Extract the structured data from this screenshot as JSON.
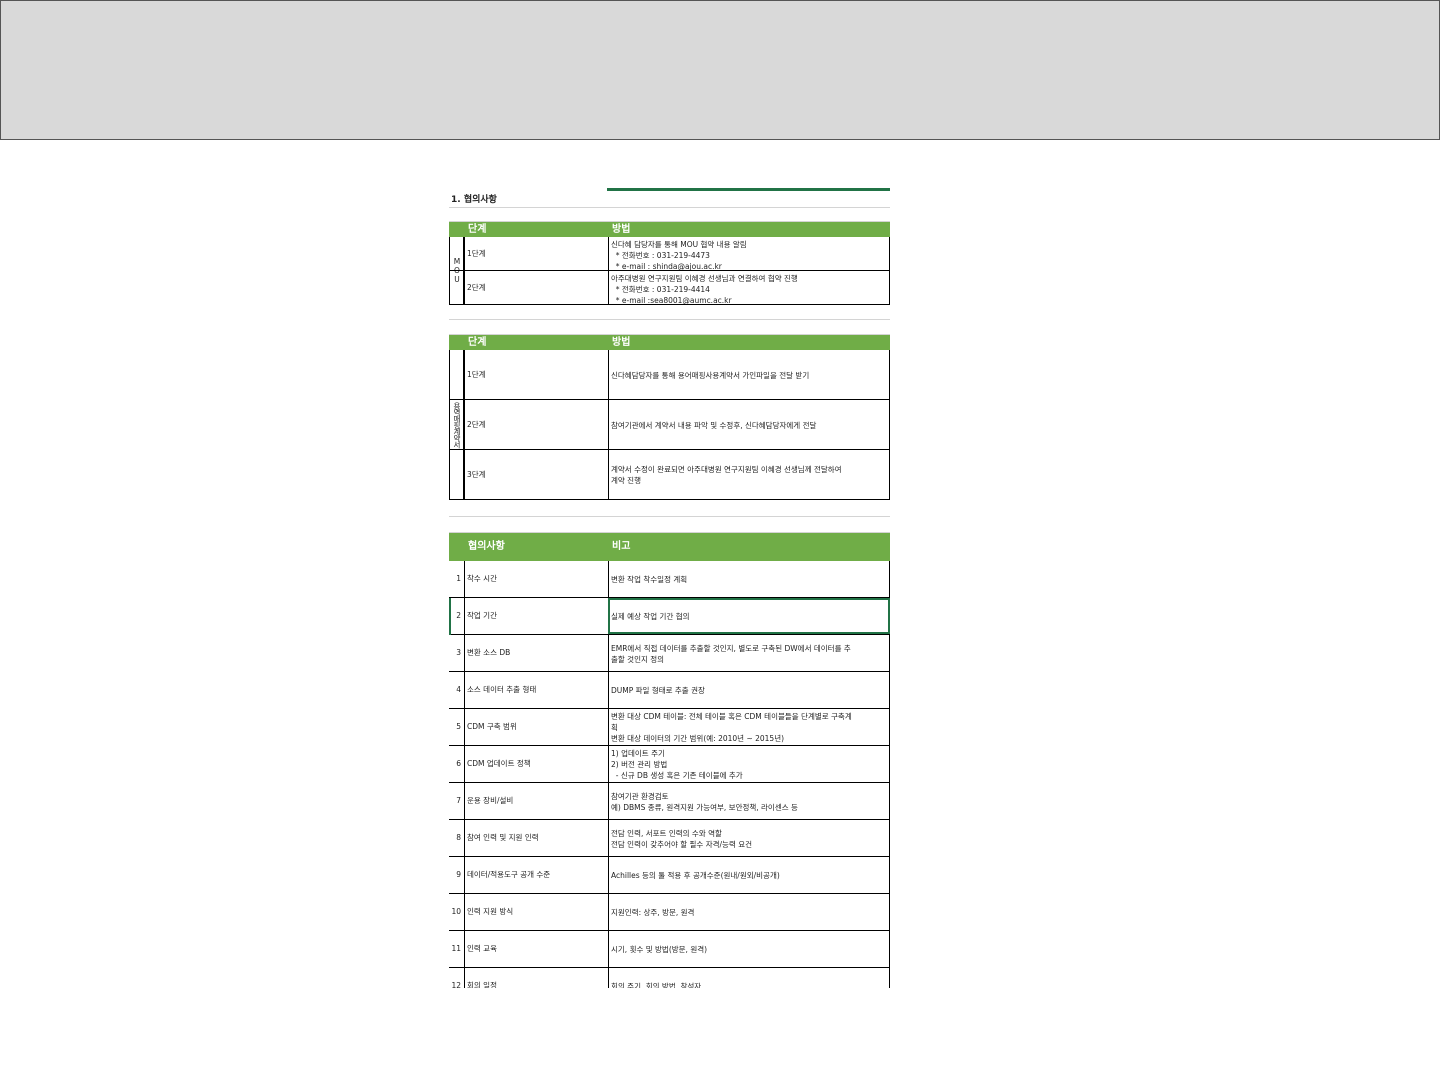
{
  "section_title": "1. 협의사항",
  "mou": {
    "label": "MOU",
    "header": {
      "stage": "단계",
      "method": "방법"
    },
    "rows": [
      {
        "stage": "1단계",
        "lines": [
          "신다혜 담당자를 통해 MOU 협약 내용 알림",
          "  * 전화번호 : 031-219-4473",
          "  * e-mail : shinda@ajou.ac.kr"
        ]
      },
      {
        "stage": "2단계",
        "lines": [
          "아주대병원 연구지원팀 이혜경 선생님과 연결하여 협약 진행",
          "  * 전화번호 : 031-219-4414",
          "  * e-mail :sea8001@aumc.ac.kr"
        ]
      }
    ]
  },
  "contract": {
    "label": "용역매핑계약서",
    "header": {
      "stage": "단계",
      "method": "방법"
    },
    "rows": [
      {
        "stage": "1단계",
        "lines": [
          "신다혜담당자를 통해 용어매핑사용계약서 가인파일을 전달 받기"
        ]
      },
      {
        "stage": "2단계",
        "lines": [
          "참여기관에서 계약서 내용 파악 및 수정후, 신다혜담당자에게 전달"
        ]
      },
      {
        "stage": "3단계",
        "lines": [
          "계약서 수정이 완료되면 아주대병원 연구지원팀 이혜경 선생님께 전달하여",
          "계약 진행"
        ]
      }
    ]
  },
  "agenda": {
    "header": {
      "item": "협의사항",
      "note": "비고"
    },
    "rows": [
      {
        "no": "1",
        "item": "착수 시간",
        "lines": [
          "변환 작업 착수일정 계획"
        ]
      },
      {
        "no": "2",
        "item": "작업 기간",
        "lines": [
          "실제 예상 작업 기간 협의"
        ]
      },
      {
        "no": "3",
        "item": "변환 소스 DB",
        "lines": [
          "EMR에서 직접 데이터를 추출할 것인지, 별도로 구축된 DW에서 데이터를 추",
          "출할 것인지 정의"
        ]
      },
      {
        "no": "4",
        "item": "소스 데이터 추출 형태",
        "lines": [
          "DUMP 파일 형태로 추출 권장"
        ]
      },
      {
        "no": "5",
        "item": "CDM 구축 범위",
        "lines": [
          "변환 대상 CDM 테이블: 전체 테이블 혹은 CDM 테이블들을 단계별로 구축계",
          "획",
          "변환 대상 데이터의 기간 범위(예: 2010년 ~ 2015년)"
        ]
      },
      {
        "no": "6",
        "item": "CDM 업데이트 정책",
        "lines": [
          "1) 업데이트 주기",
          "2) 버전 관리 방법",
          "  - 신규 DB 생성 혹은 기존 테이블에 추가"
        ]
      },
      {
        "no": "7",
        "item": "운용 장비/설비",
        "lines": [
          "참여기관 환경검토",
          "예) DBMS 종류, 원격지원 가능여부, 보안정책, 라이센스 등"
        ]
      },
      {
        "no": "8",
        "item": "참여 인력 및 지원 인력",
        "lines": [
          "전담 인력, 서포트 인력의 수와 역할",
          "전담 인력이 갖추어야 할 필수 자격/능력 요건"
        ]
      },
      {
        "no": "9",
        "item": "데이터/적용도구 공개 수준",
        "lines": [
          "Achilles 등의 툴 적용 후 공개수준(원내/원외/비공개)"
        ]
      },
      {
        "no": "10",
        "item": "인력 지원 방식",
        "lines": [
          "지원인력: 상주, 방문, 원격"
        ]
      },
      {
        "no": "11",
        "item": "인력 교육",
        "lines": [
          "시기, 횟수 및 방법(방문, 원격)"
        ]
      },
      {
        "no": "12",
        "item": "회의 일정",
        "lines": [
          "회의 주기, 회의 방법, 참석자"
        ]
      }
    ]
  }
}
